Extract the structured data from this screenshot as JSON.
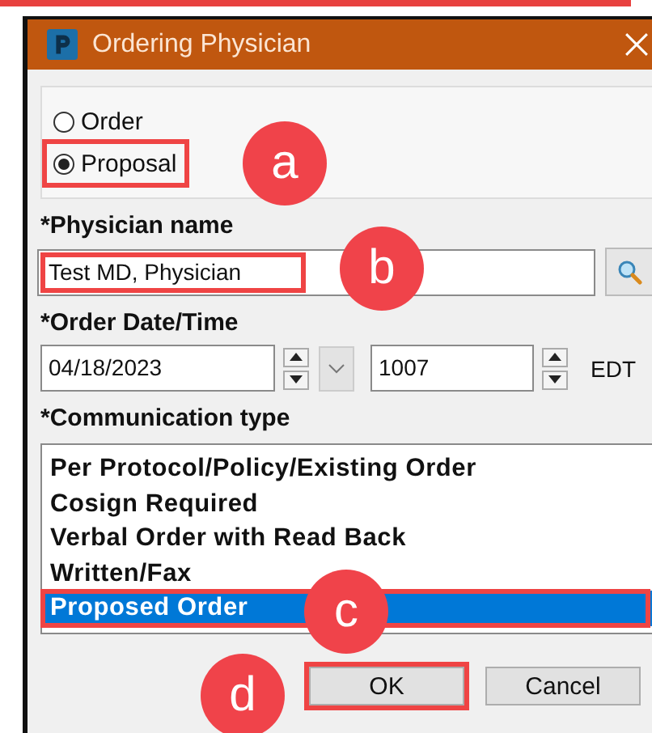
{
  "window": {
    "title": "Ordering Physician"
  },
  "order_mode": [
    {
      "label": "Order",
      "selected": false,
      "highlighted": false
    },
    {
      "label": "Proposal",
      "selected": true,
      "highlighted": true
    }
  ],
  "physician": {
    "label": "*Physician name",
    "value": "Test MD, Physician",
    "highlighted": true
  },
  "order_datetime": {
    "label": "*Order Date/Time",
    "date": "04/18/2023",
    "time": "1007",
    "timezone": "EDT"
  },
  "communication": {
    "label": "*Communication type",
    "items": [
      {
        "label": "Per Protocol/Policy/Existing Order",
        "selected": false,
        "highlighted": false
      },
      {
        "label": "Cosign Required",
        "selected": false,
        "highlighted": false
      },
      {
        "label": "Verbal Order with Read Back",
        "selected": false,
        "highlighted": false
      },
      {
        "label": "Written/Fax",
        "selected": false,
        "highlighted": false
      },
      {
        "label": "Proposed Order",
        "selected": true,
        "highlighted": true
      }
    ]
  },
  "buttons": [
    {
      "label": "OK",
      "highlighted": true
    },
    {
      "label": "Cancel",
      "highlighted": false
    }
  ],
  "annotations": [
    {
      "label": "a"
    },
    {
      "label": "b"
    },
    {
      "label": "c"
    },
    {
      "label": "d"
    }
  ]
}
